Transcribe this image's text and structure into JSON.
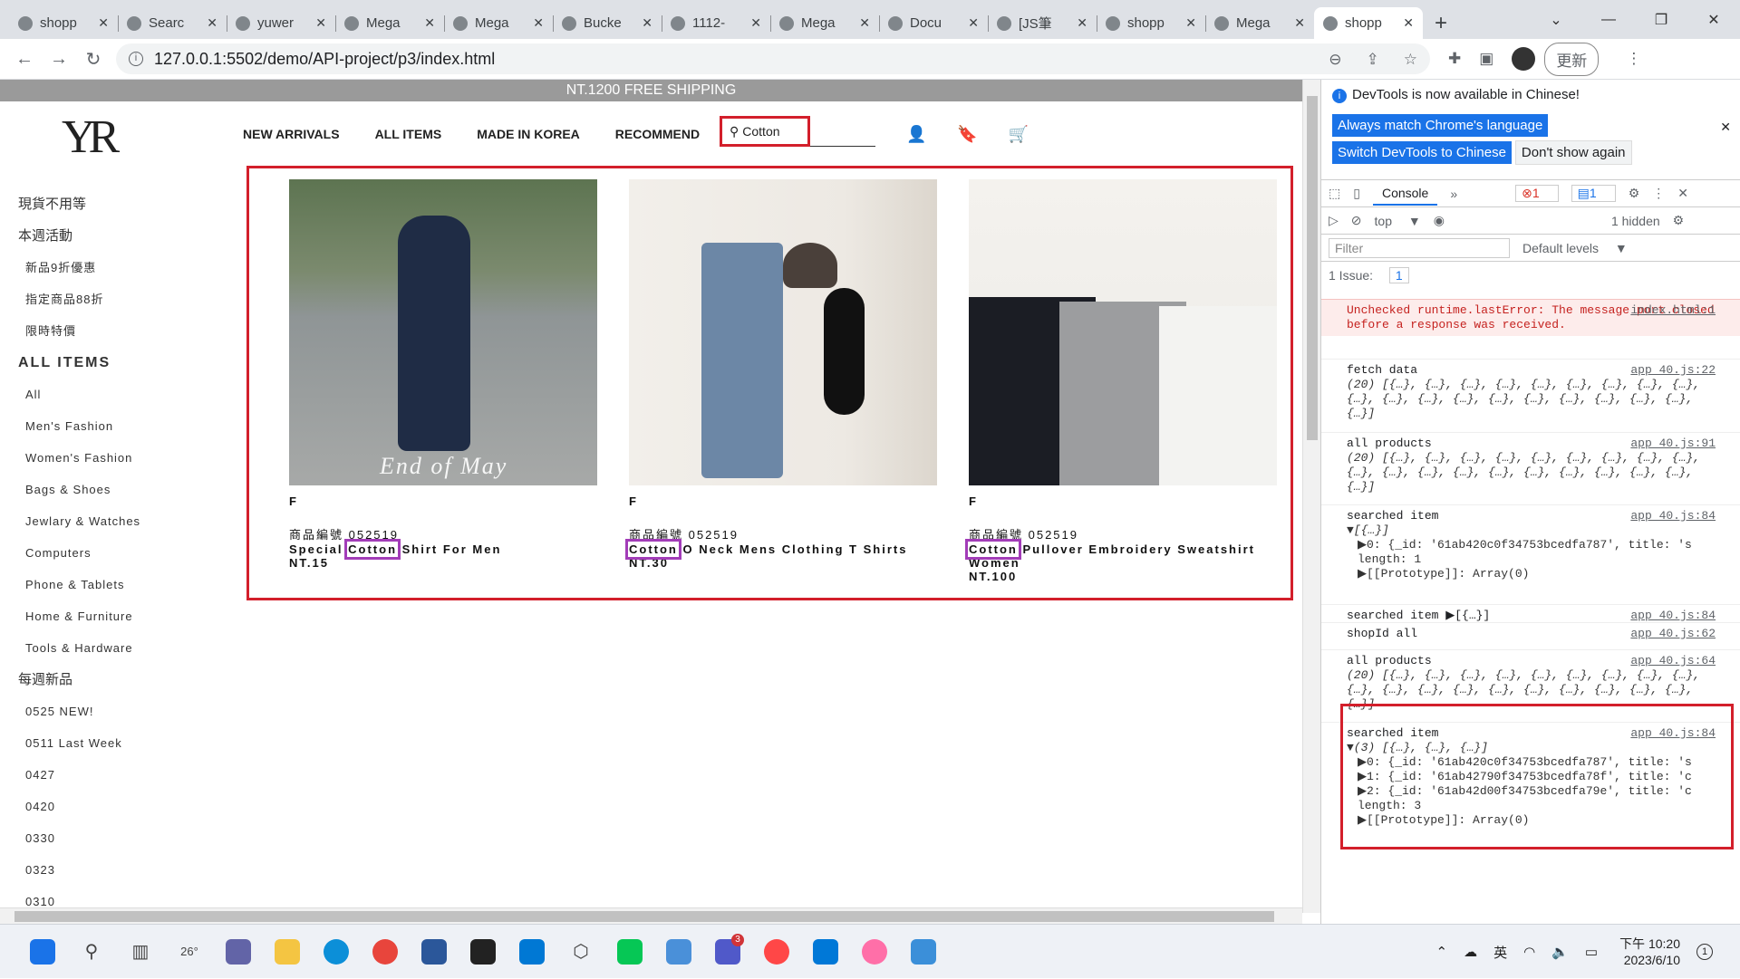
{
  "tabs": [
    {
      "label": "shopp"
    },
    {
      "label": "Searc"
    },
    {
      "label": "yuwer"
    },
    {
      "label": "Mega"
    },
    {
      "label": "Mega"
    },
    {
      "label": "Bucke"
    },
    {
      "label": "1112-"
    },
    {
      "label": "Mega"
    },
    {
      "label": "Docu"
    },
    {
      "label": "[JS筆"
    },
    {
      "label": "shopp"
    },
    {
      "label": "Mega"
    },
    {
      "label": "shopp"
    }
  ],
  "address": {
    "url": "127.0.0.1:5502/demo/API-project/p3/index.html",
    "update_label": "更新"
  },
  "page": {
    "shipping_banner": "NT.1200 FREE SHIPPING",
    "logo": "YR",
    "nav": [
      "NEW ARRIVALS",
      "ALL ITEMS",
      "MADE IN KOREA",
      "RECOMMEND"
    ],
    "search_value": "Cotton",
    "sidebar": [
      {
        "label": "現貨不用等",
        "type": "cat"
      },
      {
        "label": "本週活動",
        "type": "cat"
      },
      {
        "label": "新品9折優惠",
        "type": "sub"
      },
      {
        "label": "指定商品88折",
        "type": "sub"
      },
      {
        "label": "限時特價",
        "type": "sub"
      },
      {
        "label": "ALL ITEMS",
        "type": "head"
      },
      {
        "label": "All",
        "type": "sub"
      },
      {
        "label": "Men's Fashion",
        "type": "sub"
      },
      {
        "label": "Women's Fashion",
        "type": "sub"
      },
      {
        "label": "Bags & Shoes",
        "type": "sub"
      },
      {
        "label": "Jewlary & Watches",
        "type": "sub"
      },
      {
        "label": "Computers",
        "type": "sub"
      },
      {
        "label": "Phone & Tablets",
        "type": "sub"
      },
      {
        "label": "Home & Furniture",
        "type": "sub"
      },
      {
        "label": "Tools & Hardware",
        "type": "sub"
      },
      {
        "label": "每週新品",
        "type": "cat"
      },
      {
        "label": "0525 NEW!",
        "type": "sub"
      },
      {
        "label": "0511 Last Week",
        "type": "sub"
      },
      {
        "label": "0427",
        "type": "sub"
      },
      {
        "label": "0420",
        "type": "sub"
      },
      {
        "label": "0330",
        "type": "sub"
      },
      {
        "label": "0323",
        "type": "sub"
      },
      {
        "label": "0310",
        "type": "sub"
      }
    ],
    "products": [
      {
        "size": "F",
        "code": "商品編號 052519",
        "title_pre": "Special ",
        "title_hl": "Cotton",
        "title_post": " Shirt For Men",
        "price": "NT.15",
        "watermark": "End of May"
      },
      {
        "size": "F",
        "code": "商品編號 052519",
        "title_pre": "",
        "title_hl": "Cotton",
        "title_post": " O Neck Mens Clothing T Shirts",
        "price": "NT.30",
        "watermark": ""
      },
      {
        "size": "F",
        "code": "商品編號 052519",
        "title_pre": "",
        "title_hl": "Cotton",
        "title_post": " Pullover Embroidery Sweatshirt Women",
        "price": "NT.100",
        "watermark": ""
      }
    ]
  },
  "devtools": {
    "info": "DevTools is now available in Chinese!",
    "btn_match": "Always match Chrome's language",
    "btn_switch": "Switch DevTools to Chinese",
    "btn_dont": "Don't show again",
    "tab_console": "Console",
    "err_count": "1",
    "info_count": "1",
    "context": "top",
    "hidden": "1 hidden",
    "filter_placeholder": "Filter",
    "levels": "Default levels",
    "issues": "1 Issue:",
    "issue_count": "1",
    "logs": [
      {
        "text": "Unchecked runtime.lastError: The message port closed before a response was received.",
        "src": "index.html:1",
        "kind": "err"
      },
      {
        "text": "fetch data",
        "src": "app_40.js:22",
        "body": "(20) [{…}, {…}, {…}, {…}, {…}, {…}, {…}, {…}, {…}, {…}, {…}, {…}, {…}, {…}, {…}, {…}, {…}, {…}, {…}, {…}]"
      },
      {
        "text": "all products",
        "src": "app_40.js:91",
        "body": "(20) [{…}, {…}, {…}, {…}, {…}, {…}, {…}, {…}, {…}, {…}, {…}, {…}, {…}, {…}, {…}, {…}, {…}, {…}, {…}, {…}]"
      },
      {
        "text": "searched item",
        "src": "app_40.js:84",
        "body": "▼[{…}]",
        "lines": [
          "▶0: {_id: '61ab420c0f34753bcedfa787', title: 's",
          "length: 1",
          "▶[[Prototype]]: Array(0)"
        ]
      },
      {
        "text": "searched item ▶[{…}]",
        "src": "app_40.js:84"
      },
      {
        "text": "shopId all",
        "src": "app_40.js:62"
      },
      {
        "text": "all products",
        "src": "app_40.js:64",
        "body": "(20) [{…}, {…}, {…}, {…}, {…}, {…}, {…}, {…}, {…}, {…}, {…}, {…}, {…}, {…}, {…}, {…}, {…}, {…}, {…}, {…}]"
      },
      {
        "text": "searched item",
        "src": "app_40.js:84",
        "body": "▼(3) [{…}, {…}, {…}]",
        "lines": [
          "▶0: {_id: '61ab420c0f34753bcedfa787', title: 's",
          "▶1: {_id: '61ab42790f34753bcedfa78f', title: 'c",
          "▶2: {_id: '61ab42d00f34753bcedfa79e', title: 'c",
          "length: 3",
          "▶[[Prototype]]: Array(0)"
        ]
      }
    ]
  },
  "taskbar": {
    "weather": "26°",
    "teams_badge": "3",
    "ime": "英",
    "time": "下午 10:20",
    "date": "2023/6/10",
    "notif": "1"
  }
}
